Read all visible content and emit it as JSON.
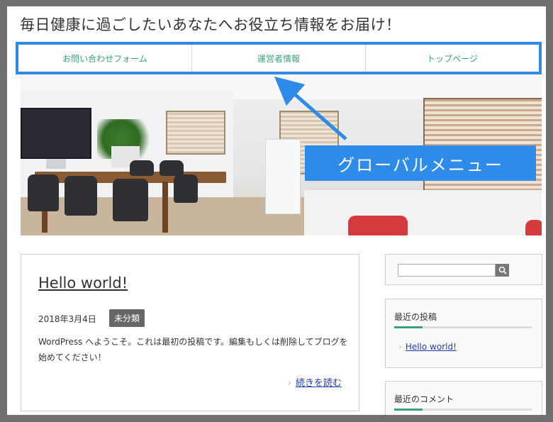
{
  "site": {
    "title": "毎日健康に過ごしたいあなたへお役立ち情報をお届け！"
  },
  "nav": {
    "items": [
      {
        "label": "お問い合わせフォーム"
      },
      {
        "label": "運営者情報"
      },
      {
        "label": "トップページ"
      }
    ]
  },
  "annotation": {
    "label": "グローバルメニュー",
    "color": "#2f8bea"
  },
  "post": {
    "title": "Hello world!",
    "date": "2018年3月4日",
    "category": "未分類",
    "excerpt": "WordPress へようこそ。これは最初の投稿です。編集もしくは削除してブログを始めてください！",
    "read_more": "続きを読む"
  },
  "sidebar": {
    "search": {
      "placeholder": "",
      "icon": "search-icon"
    },
    "recent_posts": {
      "title": "最近の投稿",
      "items": [
        {
          "label": "Hello world!"
        }
      ]
    },
    "recent_comments": {
      "title": "最近のコメント"
    }
  },
  "colors": {
    "accent_green": "#3aa27a",
    "link_blue": "#1f3db5"
  }
}
